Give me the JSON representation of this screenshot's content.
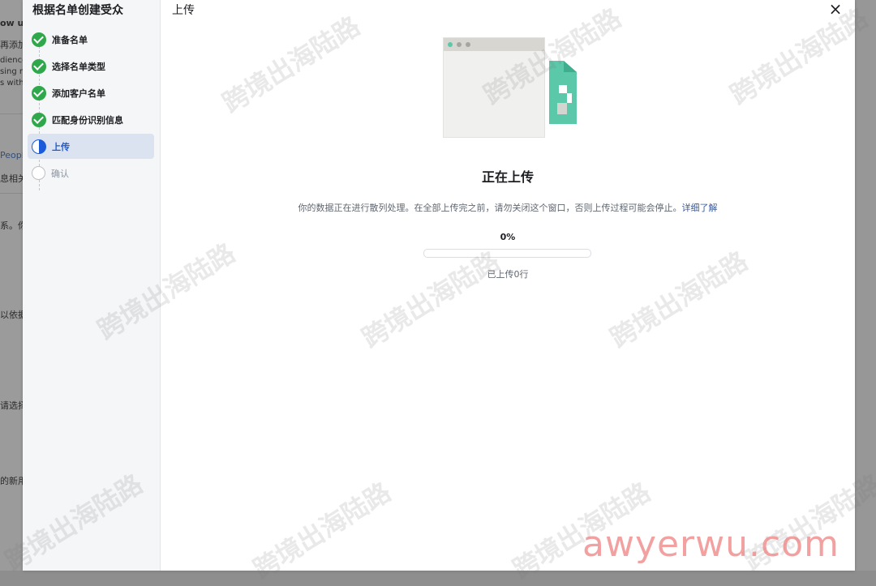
{
  "background": {
    "fragments": [
      "ow us",
      "再添加",
      "dience",
      "sing re",
      "s with",
      "People",
      "息相关",
      "系。你",
      "以依据",
      "请选择",
      "的新用"
    ]
  },
  "modal": {
    "sidebar": {
      "title": "根据名单创建受众",
      "steps": [
        {
          "label": "准备名单",
          "state": "done"
        },
        {
          "label": "选择名单类型",
          "state": "done"
        },
        {
          "label": "添加客户名单",
          "state": "done"
        },
        {
          "label": "匹配身份识别信息",
          "state": "done"
        },
        {
          "label": "上传",
          "state": "active"
        },
        {
          "label": "确认",
          "state": "todo"
        }
      ]
    },
    "header": {
      "title": "上传",
      "close_label": "×"
    },
    "upload": {
      "heading": "正在上传",
      "description": "你的数据正在进行散列处理。在全部上传完之前，请勿关闭这个窗口，否则上传过程可能会停止。",
      "learn_more": "详细了解",
      "progress_percent": 0,
      "progress_label": "0%",
      "uploaded_rows_text": "已上传0行"
    }
  },
  "watermark": {
    "text": "跨境出海陆路",
    "site": "awyerwu.com"
  },
  "colors": {
    "accent": "#1b5ad8",
    "done": "#2ea84a",
    "link": "#385898",
    "teal": "#5cc8aa"
  }
}
